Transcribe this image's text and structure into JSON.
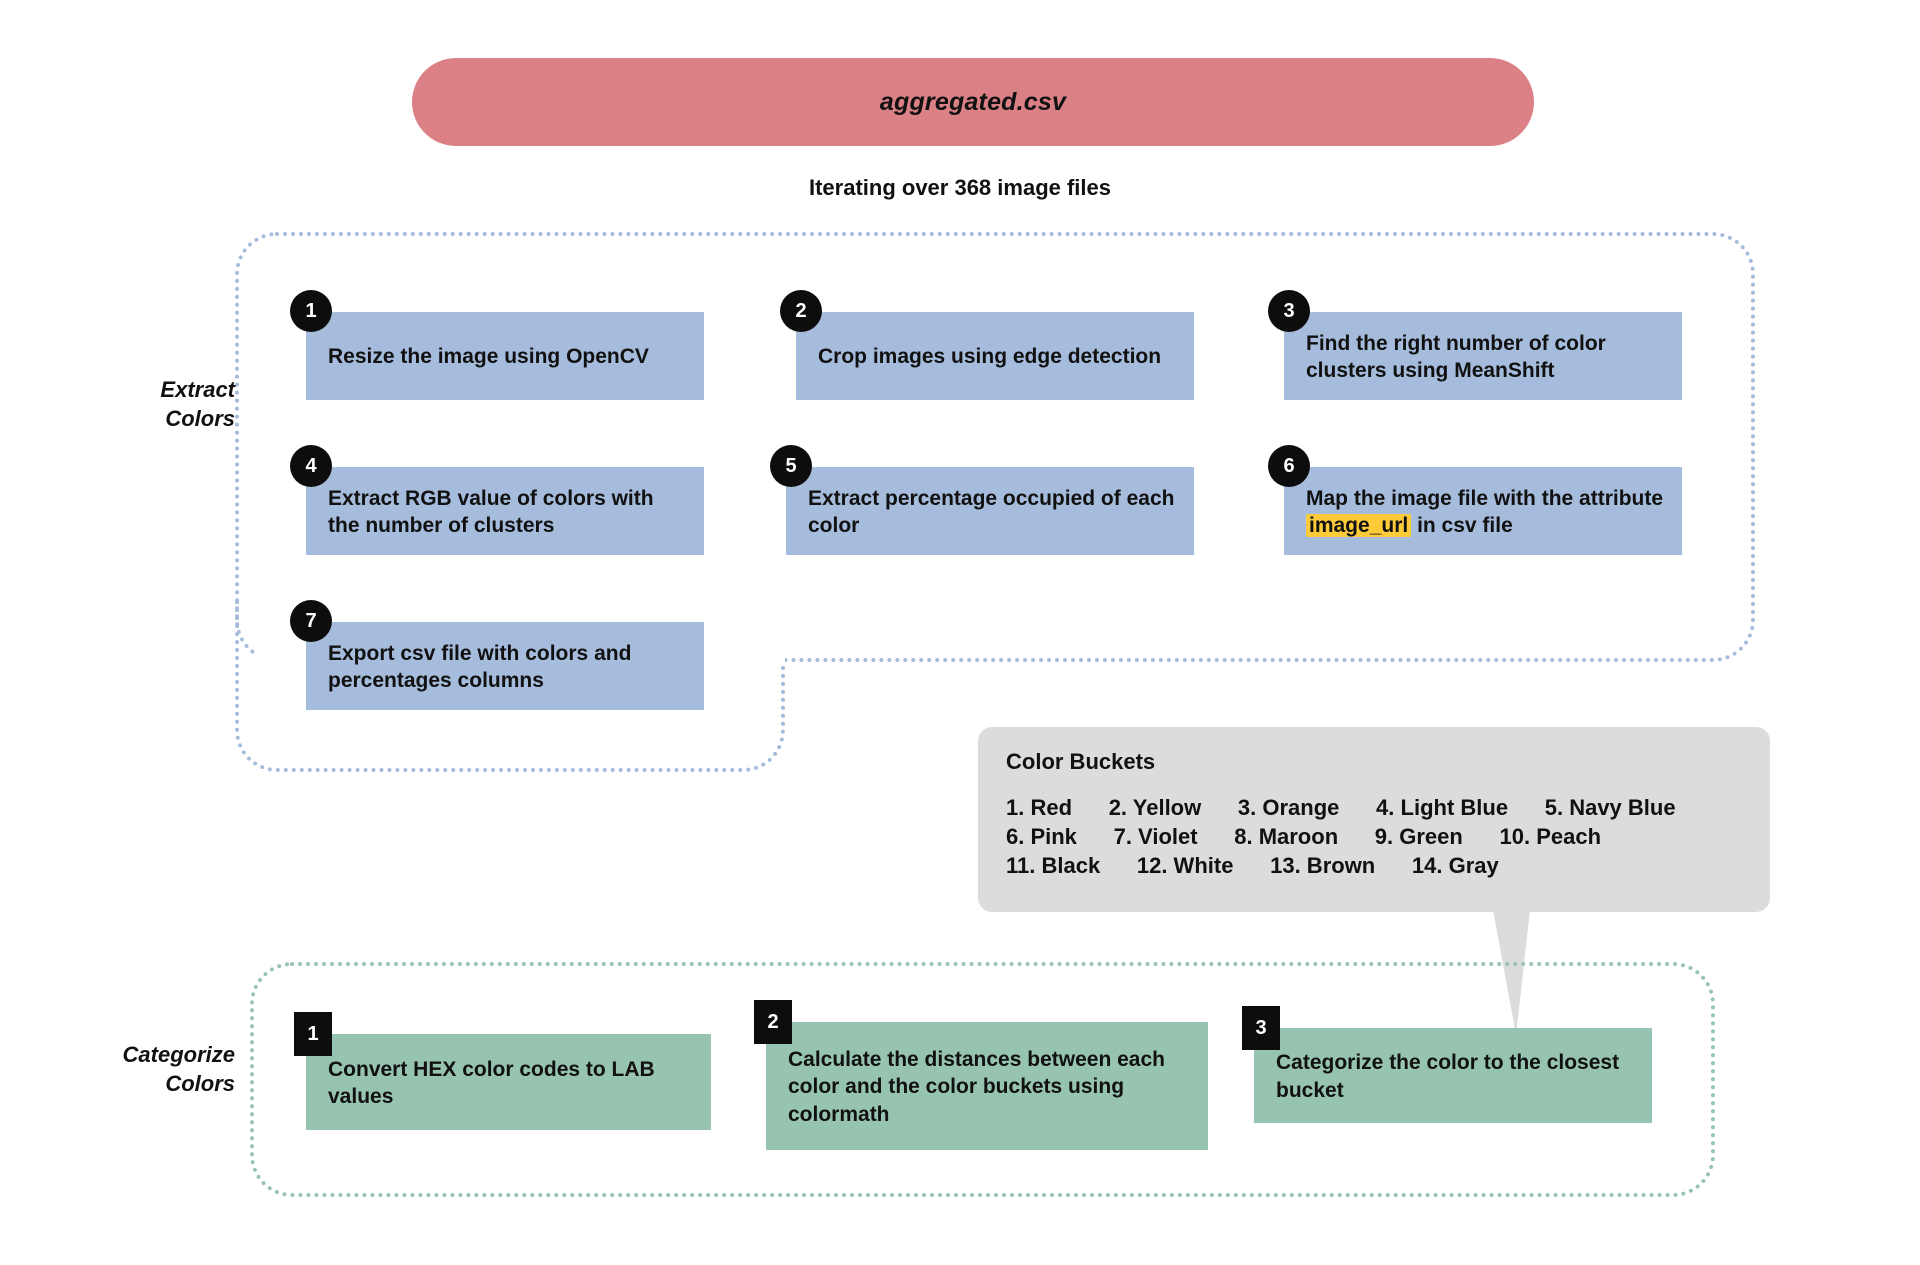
{
  "source": {
    "label": "aggregated.csv"
  },
  "iteration": {
    "caption": "Iterating over 368 image files"
  },
  "sections": [
    {
      "id": "extract",
      "label_line1": "Extract",
      "label_line2": "Colors",
      "accent": "#a6bcdc",
      "steps": [
        {
          "num": "1",
          "text": "Resize the image using OpenCV"
        },
        {
          "num": "2",
          "text": "Crop images using edge detection"
        },
        {
          "num": "3",
          "text": "Find the right number of color clusters using MeanShift"
        },
        {
          "num": "4",
          "text": "Extract RGB value of colors with the number of clusters"
        },
        {
          "num": "5",
          "text": "Extract percentage occupied of each color"
        },
        {
          "num": "6",
          "text_before": "Map the image file with the attribute",
          "highlight": "image_url",
          "text_after": "in csv file"
        },
        {
          "num": "7",
          "text": "Export csv file with colors and percentages columns"
        }
      ]
    },
    {
      "id": "categorize",
      "label_line1": "Categorize",
      "label_line2": "Colors",
      "accent": "#97c4b0",
      "steps": [
        {
          "num": "1",
          "text": "Convert HEX color codes to LAB values"
        },
        {
          "num": "2",
          "text": "Calculate the distances between each color and the color buckets using colormath"
        },
        {
          "num": "3",
          "text": "Categorize the color to the closest bucket"
        }
      ]
    }
  ],
  "color_buckets": {
    "title": "Color Buckets",
    "row1": "1. Red      2. Yellow      3. Orange      4. Light Blue      5. Navy Blue",
    "row2": "6. Pink      7. Violet      8. Maroon      9. Green      10. Peach",
    "row3": "11. Black      12. White      13. Brown      14. Gray",
    "items": [
      "1. Red",
      "2. Yellow",
      "3. Orange",
      "4. Light Blue",
      "5. Navy Blue",
      "6. Pink",
      "7. Violet",
      "8. Maroon",
      "9. Green",
      "10. Peach",
      "11. Black",
      "12. White",
      "13. Brown",
      "14. Gray"
    ]
  },
  "colors": {
    "source_pill": "#db8186",
    "extract_box": "#a6bcdc",
    "categorize_box": "#97c4b0",
    "badge": "#0d0d0d",
    "highlight": "#fdca3a",
    "callout": "#dcdcdc",
    "background": "#ffffff"
  }
}
